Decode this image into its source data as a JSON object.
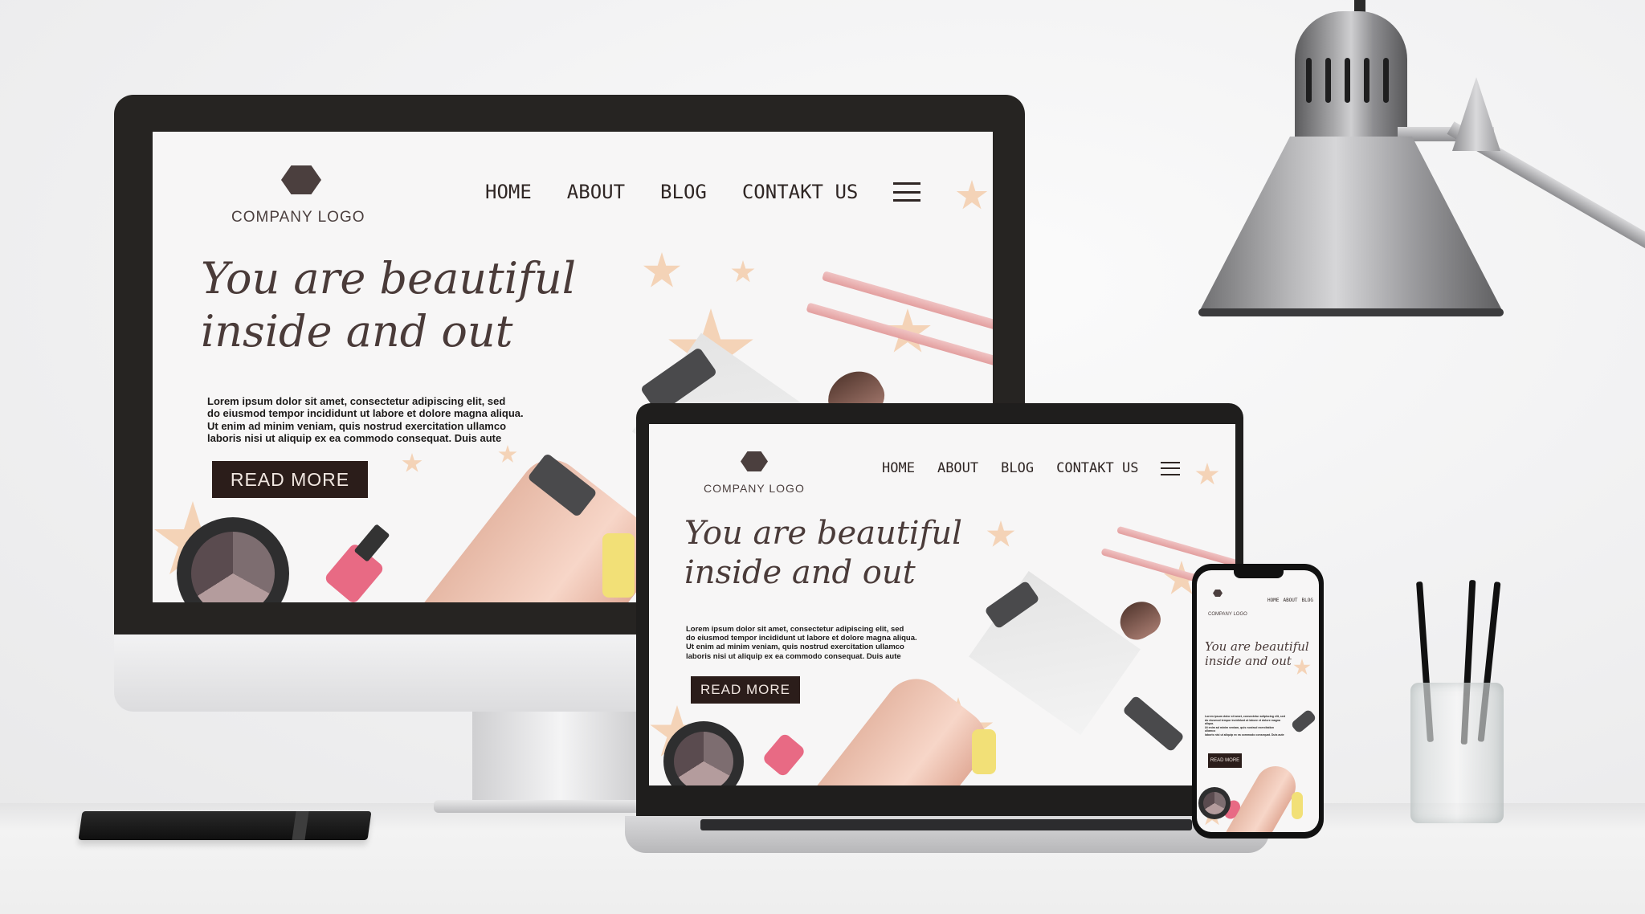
{
  "site": {
    "logo_text": "COMPANY LOGO",
    "nav": [
      {
        "label": "HOME"
      },
      {
        "label": "ABOUT"
      },
      {
        "label": "BLOG"
      },
      {
        "label": "CONTAKT US"
      }
    ],
    "hero_line1": "You are beautiful",
    "hero_line2": "inside and out",
    "body_lines": [
      "Lorem ipsum dolor sit amet, consectetur adipiscing elit, sed",
      "do eiusmod tempor incididunt ut labore et dolore magna aliqua.",
      "Ut enim ad minim veniam, quis nostrud exercitation ullamco",
      "laboris nisi ut aliquip ex ea commodo consequat. Duis aute"
    ],
    "button_label": "READ MORE"
  },
  "colors": {
    "accent_dark": "#2b1d1a",
    "text_brown": "#4a3b39",
    "star_peach": "#f3cfb0",
    "screen_bg": "#f7f6f6"
  },
  "icons": {
    "menu": "hamburger-icon",
    "logo": "hexagon-logo-icon",
    "decor": "star-icon"
  }
}
